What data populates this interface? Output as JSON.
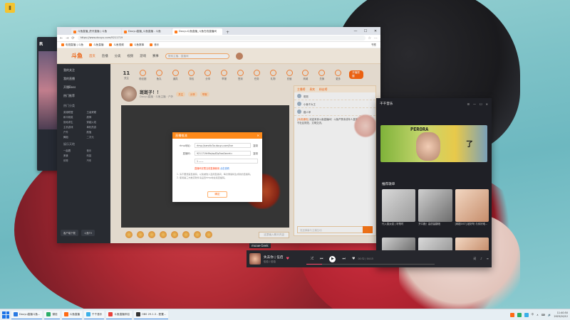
{
  "desktop": {
    "icon_label": "Ⅱ",
    "sidebar_title": "R"
  },
  "browser": {
    "tabs": [
      {
        "label": "斗鱼直播_虎牙直播 | 斗鱼"
      },
      {
        "label": "Douyu直播_斗鱼直播 - 斗鱼"
      },
      {
        "label": "Douyu斗鱼直播_斗鱼在线直播间"
      }
    ],
    "new_tab": "+",
    "controls": {
      "min": "—",
      "max": "☐",
      "close": "✕"
    },
    "url": "https://www.douyu.com/9211719",
    "bookmarks": [
      "电视直播 | 斗鱼",
      "斗鱼直播",
      "斗鱼视频",
      "斗鱼赛事",
      "音乐"
    ],
    "bookmark_right": "书签"
  },
  "site": {
    "logo": "斗鱼",
    "nav": [
      "首页",
      "直播",
      "分类",
      "视频",
      "游戏",
      "赛事"
    ],
    "search_placeholder": "搜索主播、直播间",
    "left_menu": {
      "items": [
        "我的关注",
        "我的直播",
        "开播Boss",
        "热门推荐"
      ],
      "section1": "热门分类",
      "grid1": [
        "英雄联盟",
        "王者荣耀",
        "和平精英",
        "原神",
        "绝地求生",
        "穿越火线",
        "主机游戏",
        "单机热游",
        "户外",
        "颜值",
        "舞蹈",
        "二次元"
      ],
      "section2": "娱乐天地",
      "grid2": [
        "一起看",
        "音乐",
        "美食",
        "科技",
        "体育",
        "汽车"
      ],
      "buttons": [
        "客户端下载",
        "斗鱼TV"
      ]
    },
    "iconbar": {
      "count": "11",
      "count_label": "关注",
      "icons": [
        "粉丝团",
        "鱼丸",
        "道具",
        "背包",
        "分享",
        "举报",
        "签到",
        "任务",
        "礼物",
        "充值",
        "商城",
        "兑换",
        "更多"
      ],
      "pill": "开播提醒"
    },
    "streamer": {
      "name": "斑斑子！！",
      "sub": "Douyu直播 · 斗鱼主播 · 户外",
      "tags": [
        "关注",
        "分享",
        "举报"
      ]
    },
    "chat_placeholder": "这里输入聊天内容",
    "right_panel": {
      "tabs": [
        "主播榜",
        "贵宾",
        "粉丝榜"
      ],
      "rows": [
        "斑斑",
        "小鱼干大王",
        "路人甲"
      ],
      "message_label": "[系统通知]",
      "message": "欢迎来到斗鱼直播间！斗鱼严禁未成年人直播或打赏，请遵守社区规范，文明交流。",
      "input_placeholder": "发送弹幕与主播互动"
    }
  },
  "modal": {
    "title": "直播推流",
    "close": "✕",
    "rows": [
      {
        "label": "rtmp地址：",
        "value": "rtmp://sendtc3a.douyu.com/live",
        "action": "复制"
      },
      {
        "label": "直播码：",
        "value": "9211719rMwJrq4Dp?wsSecret=",
        "action": "复制"
      }
    ],
    "select_value": "1 ——",
    "warning": "直播码仅限当前直播使用",
    "warning_link": "点击查看",
    "tips": [
      "1. 请不要泄露直播码，以免被他人盗用直播间，每次重播将生成新的直播码。",
      "2. 使用第三方推流软件请设置rtmp地址和直播码。"
    ],
    "button": "确定"
  },
  "player": {
    "logo": "千千音乐",
    "top_controls": [
      "☰",
      "—",
      "☐",
      "✕"
    ],
    "banner_text": "PERORA",
    "banner_tag": "了",
    "section": "推荐歌单",
    "thumbs": [
      "代入感太强 | 听歌时",
      "开口跪！高质量翻唱",
      "[韩剧OST] 超好听 与你好难..."
    ],
    "now_playing": {
      "title": "失去你 | 伍佰",
      "sub": "伍佰 / 伍佰",
      "mini": "moaw·Geek"
    },
    "controls": [
      "⤮",
      "⏮",
      "▶",
      "⏭",
      "♥"
    ],
    "time": "00:32 / 04:15",
    "progress": 0.12,
    "right": [
      "词",
      "♪",
      "≡"
    ]
  },
  "taskbar": {
    "items": [
      "Douyu直播斗鱼...",
      "微信",
      "斗鱼直播",
      "千千音乐",
      "斗鱼直播伴侣",
      "OBS 29.1.3 - 配置..."
    ],
    "tray": [
      "中",
      "∧",
      "⌨",
      "🔊"
    ],
    "time": "11:40:50",
    "date": "2023/10/12"
  },
  "colors": {
    "accent": "#ff6a13",
    "player_bg": "#1f2026"
  }
}
